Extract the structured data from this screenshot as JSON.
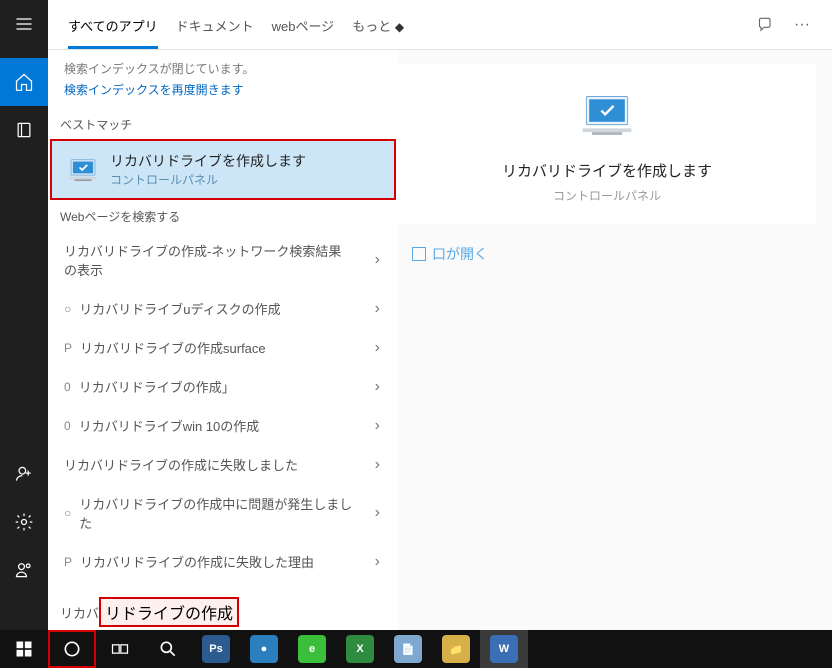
{
  "tabs": {
    "all_apps": "すべてのアプリ",
    "document": "ドキュメント",
    "web": "webページ",
    "more": "もっと",
    "more_symbol": "◆"
  },
  "index": {
    "warn": "検索インデックスが閉じています。",
    "link": "検索インデックスを再度開きます"
  },
  "sections": {
    "best_match": "ベストマッチ",
    "search_web": "Webページを検索する"
  },
  "best_match": {
    "title": "リカバリドライブを作成します",
    "subtitle": "コントロールパネル"
  },
  "web_results": [
    {
      "prefix": "",
      "text": "リカバリドライブの作成-ネットワーク検索結果の表示"
    },
    {
      "prefix": "○",
      "text": "リカバリドライブuディスクの作成"
    },
    {
      "prefix": "P",
      "text": "リカバリドライブの作成surface"
    },
    {
      "prefix": "0",
      "text": "リカバリドライブの作成」"
    },
    {
      "prefix": "0",
      "text": "リカバリドライブwin 10の作成"
    },
    {
      "prefix": "",
      "text": "リカバリドライブの作成に失敗しました"
    },
    {
      "prefix": "○",
      "text": "リカバリドライブの作成中に問題が発生しました"
    },
    {
      "prefix": "P",
      "text": "リカバリドライブの作成に失敗した理由"
    }
  ],
  "preview": {
    "title": "リカバリドライブを作成します",
    "subtitle": "コントロールパネル",
    "action": "口が開く"
  },
  "search": {
    "prefix": "リカバ",
    "highlighted": "リドライブの作成"
  },
  "taskbar_apps": [
    {
      "name": "photoshop",
      "label": "Ps",
      "bg": "#2b5b8f"
    },
    {
      "name": "360browser",
      "label": "●",
      "bg": "#2b7fbf"
    },
    {
      "name": "ie",
      "label": "e",
      "bg": "#3bbf3b"
    },
    {
      "name": "excel",
      "label": "X",
      "bg": "#2f8b3f"
    },
    {
      "name": "notepad",
      "label": "📄",
      "bg": "#7fa8cf"
    },
    {
      "name": "explorer",
      "label": "📁",
      "bg": "#d6b14a"
    },
    {
      "name": "word",
      "label": "W",
      "bg": "#3b6fb5",
      "active": true
    }
  ]
}
